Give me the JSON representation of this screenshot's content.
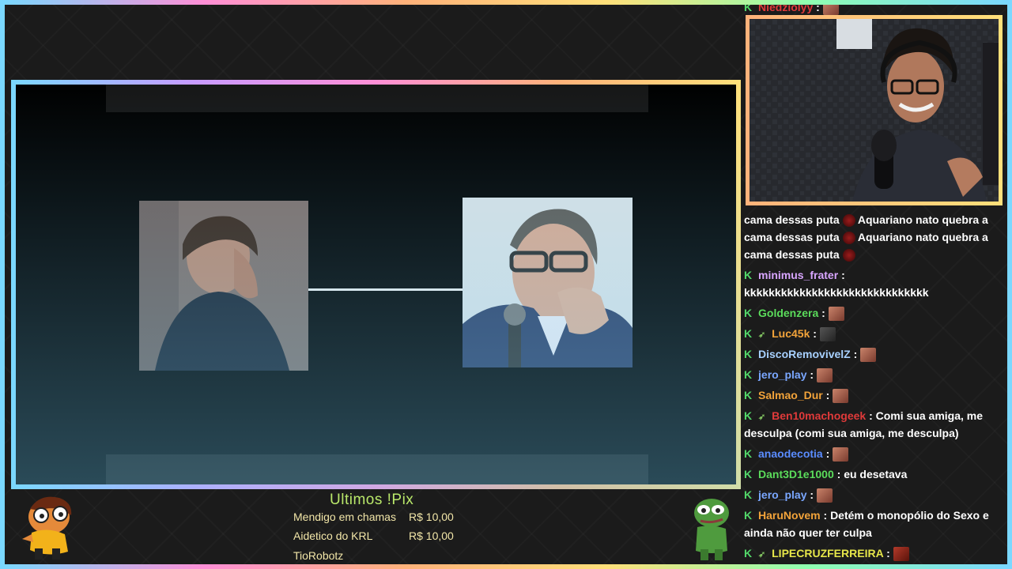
{
  "overlay": {
    "accent_colors": [
      "#7ad8ff",
      "#ff8fd6",
      "#ffb27a",
      "#ffe07a",
      "#8fffb0"
    ]
  },
  "video": {
    "left_photo": "person-portrait-icon",
    "right_photo": "speaker-portrait-icon"
  },
  "chat": {
    "messages": [
      {
        "user": "Niedziolyy",
        "user_color": "#e03a3a",
        "text": "",
        "emote": "emote"
      },
      {
        "user": "",
        "text": "cama dessas puta",
        "cont": "Aquariano nato quebra a"
      },
      {
        "user": "",
        "text": "cama dessas puta",
        "cont": "Aquariano nato quebra a"
      },
      {
        "user": "",
        "text": "cama dessas puta",
        "cont": "Aquariano nato quebra a"
      },
      {
        "user": "",
        "text": "cama dessas puta",
        "cont": ""
      },
      {
        "user": "minimus_frater",
        "user_color": "#d9a6ff",
        "text": ""
      },
      {
        "user": "",
        "text": "kkkkkkkkkkkkkkkkkkkkkkkkkkkkkk"
      },
      {
        "user": "Goldenzera",
        "user_color": "#5bdc5b",
        "text": ""
      },
      {
        "user": "Luc45k",
        "user_color": "#f2a33a",
        "text": ""
      },
      {
        "user": "DiscoRemovivelZ",
        "user_color": "#a8d1ff",
        "text": ""
      },
      {
        "user": "jero_play",
        "user_color": "#7aa7ff",
        "text": ""
      },
      {
        "user": "Salmao_Dur",
        "user_color": "#f2a33a",
        "text": ""
      },
      {
        "user": "Ben10machogeek",
        "user_color": "#e03a3a",
        "text": "Comi sua amiga, me"
      },
      {
        "user": "",
        "text": "desculpa (comi sua amiga, me desculpa)"
      },
      {
        "user": "anaodecotia",
        "user_color": "#5a8cff",
        "text": ""
      },
      {
        "user": "Dant3D1e1000",
        "user_color": "#5bdc5b",
        "text": "eu desetava"
      },
      {
        "user": "jero_play",
        "user_color": "#7aa7ff",
        "text": ""
      },
      {
        "user": "HaruNovem",
        "user_color": "#f2a33a",
        "text": "Detém o monopólio do Sexo e"
      },
      {
        "user": "",
        "text": "ainda não quer ter culpa"
      },
      {
        "user": "LIPECRUZFERREIRA",
        "user_color": "#e6e64a",
        "text": ""
      }
    ]
  },
  "pix": {
    "title": "Ultimos !Pix",
    "entries": [
      {
        "name": "Mendigo em chamas",
        "amount": "R$ 10,00"
      },
      {
        "name": "Aidetico do KRL",
        "amount": "R$ 10,00"
      },
      {
        "name": "TioRobotz",
        "amount": ""
      }
    ]
  }
}
